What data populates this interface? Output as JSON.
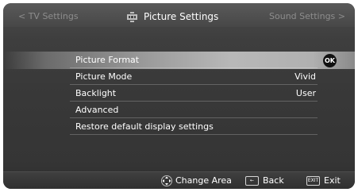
{
  "header": {
    "nav_left": "< TV Settings",
    "title": "Picture Settings",
    "title_icon": "picture-icon",
    "nav_right": "Sound Settings >"
  },
  "menu": {
    "items": [
      {
        "label": "Picture Format",
        "value": "",
        "selected": true
      },
      {
        "label": "Picture Mode",
        "value": "Vivid",
        "selected": false
      },
      {
        "label": "Backlight",
        "value": "User",
        "selected": false
      },
      {
        "label": "Advanced",
        "value": "",
        "selected": false
      },
      {
        "label": "Restore default display settings",
        "value": "",
        "selected": false
      }
    ],
    "ok_label": "OK"
  },
  "footer": {
    "change_area_label": "Change Area",
    "change_area_icon": "dpad-icon",
    "back_label": "Back",
    "back_key": "←",
    "exit_label": "Exit",
    "exit_key": "EXIT"
  },
  "colors": {
    "background": "#383838",
    "text": "#ffffff",
    "nav_text": "#8d8d8d",
    "highlight": "#b8b8b8"
  }
}
